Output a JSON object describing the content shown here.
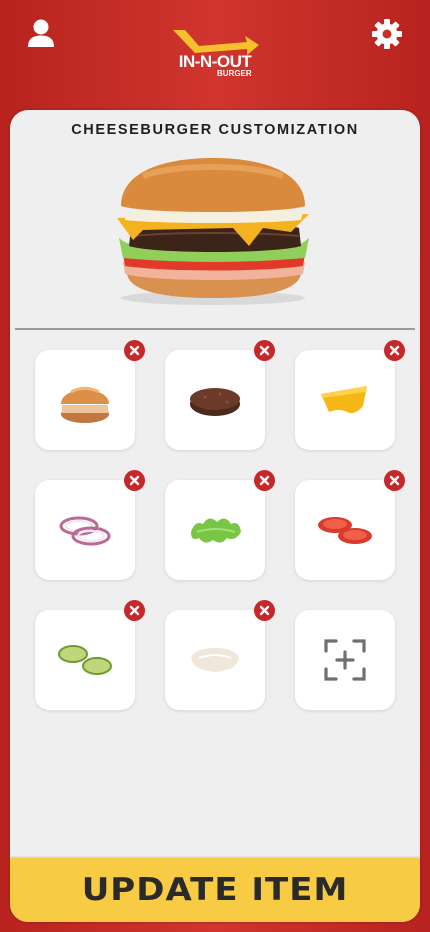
{
  "header": {
    "logo_text": "IN-N-OUT",
    "logo_subtext": "BURGER",
    "profile_icon": "user-icon",
    "settings_icon": "gear-icon"
  },
  "panel": {
    "title": "CHEESEBURGER CUSTOMIZATION"
  },
  "ingredients": [
    {
      "name": "bun",
      "icon": "bun-icon",
      "removable": true
    },
    {
      "name": "patty",
      "icon": "patty-icon",
      "removable": true
    },
    {
      "name": "cheese",
      "icon": "cheese-icon",
      "removable": true
    },
    {
      "name": "onion",
      "icon": "onion-icon",
      "removable": true
    },
    {
      "name": "lettuce",
      "icon": "lettuce-icon",
      "removable": true
    },
    {
      "name": "tomato",
      "icon": "tomato-icon",
      "removable": true
    },
    {
      "name": "pickles",
      "icon": "pickles-icon",
      "removable": true
    },
    {
      "name": "spread",
      "icon": "spread-icon",
      "removable": true
    }
  ],
  "add_tile": {
    "icon": "add-ingredient-icon"
  },
  "update_button": {
    "label": "UPDATE ITEM"
  },
  "colors": {
    "brand_red": "#c4282b",
    "accent_yellow": "#f7cb43",
    "panel_bg": "#efefef",
    "text_dark": "#2a2a2a"
  }
}
